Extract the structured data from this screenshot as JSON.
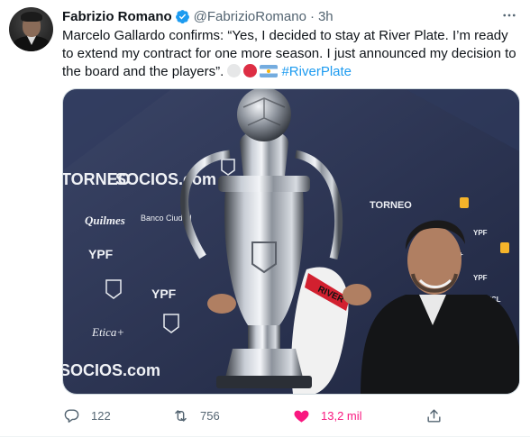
{
  "tweet": {
    "author_name": "Fabrizio Romano",
    "handle": "@FabrizioRomano",
    "separator": "·",
    "time": "3h",
    "text": "Marcelo Gallardo confirms: “Yes, I decided to stay at River Plate. I’m ready to extend my contract for one more season. I just announced my decision to the board and the players”.",
    "hashtag": "#RiverPlate",
    "emojis": [
      "white-circle",
      "red-circle",
      "argentina-flag"
    ],
    "image_alt": "Marcelo Gallardo holding a large silver trophy in front of a sponsor backdrop",
    "backdrop_text": {
      "socios_1": "SOCIOS.com",
      "socios_2": "SOCIOS.com",
      "torneo_1": "TORNEO",
      "torneo_2": "TORNEO",
      "ypf_1": "YPF",
      "ypf_2": "YPF",
      "quilmes": "Quilmes",
      "etica": "Etica+",
      "banco": "Banco Ciudad"
    },
    "actions": {
      "reply_count": "122",
      "retweet_count": "756",
      "like_count": "13,2 mil"
    },
    "colors": {
      "accent": "#1d9bf0",
      "like": "#f91880",
      "muted": "#536471",
      "backdrop": "#2a3352"
    }
  }
}
